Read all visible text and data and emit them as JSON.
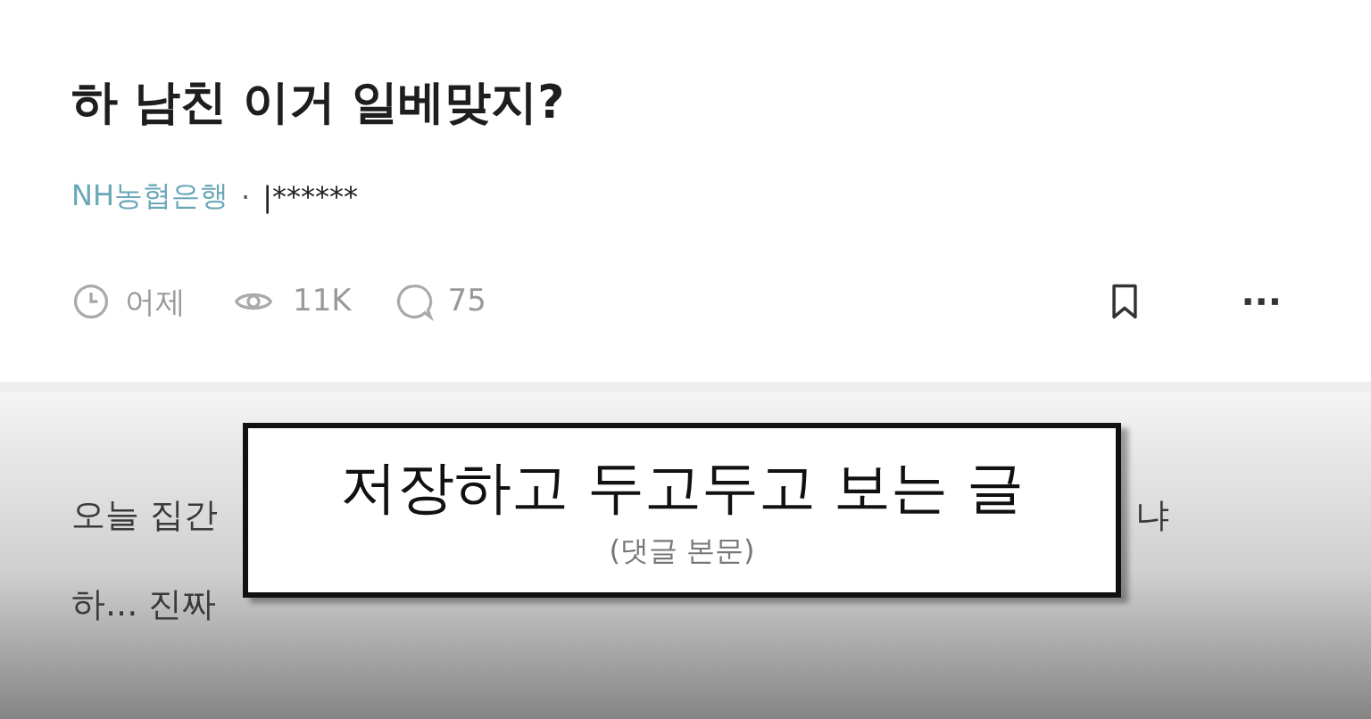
{
  "post": {
    "title": "하 남친 이거 일베맞지?",
    "company": "NH농협은행",
    "separator": "·",
    "author": "|******",
    "time": "어제",
    "views": "11K",
    "comments": "75",
    "more": "···"
  },
  "body": {
    "lines": [
      {
        "start": "오늘 집간",
        "end": "냐"
      },
      {
        "start": "하... 진짜"
      }
    ]
  },
  "caption": {
    "title": "저장하고 두고두고 보는 글",
    "subtitle": "(댓글 본문)"
  }
}
